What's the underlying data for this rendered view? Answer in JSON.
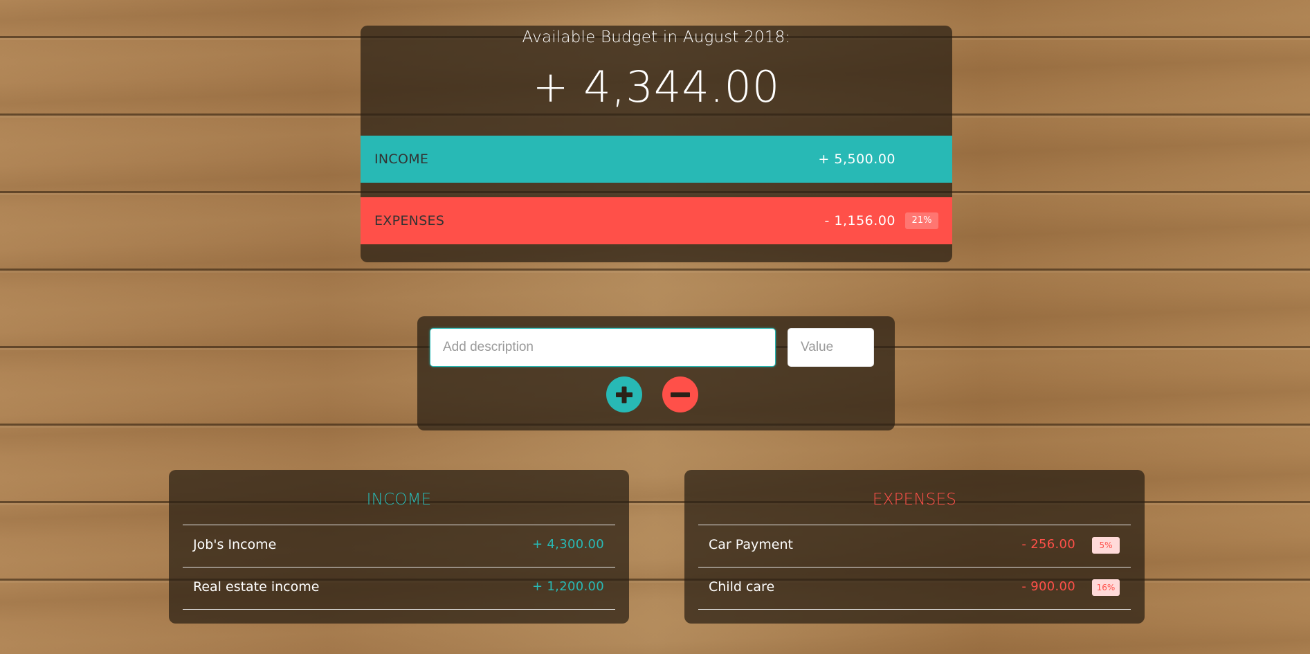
{
  "budget": {
    "title": "Available Budget in August 2018:",
    "value": "+ 4,344.00"
  },
  "summary": {
    "income": {
      "label": "Income",
      "value": "+ 5,500.00"
    },
    "expenses": {
      "label": "Expenses",
      "value": "- 1,156.00",
      "percentage": "21%"
    }
  },
  "add_form": {
    "description_placeholder": "Add description",
    "value_placeholder": "Value",
    "add_icon": "plus-circle-icon",
    "subtract_icon": "minus-circle-icon"
  },
  "income_list": {
    "title": "Income",
    "items": [
      {
        "description": "Job's Income",
        "value": "+ 4,300.00"
      },
      {
        "description": "Real estate income",
        "value": "+ 1,200.00"
      }
    ]
  },
  "expenses_list": {
    "title": "Expenses",
    "items": [
      {
        "description": "Car Payment",
        "value": "- 256.00",
        "percentage": "5%"
      },
      {
        "description": "Child care",
        "value": "- 900.00",
        "percentage": "16%"
      }
    ]
  },
  "colors": {
    "income": "#28b9b5",
    "expenses": "#ff5049"
  }
}
